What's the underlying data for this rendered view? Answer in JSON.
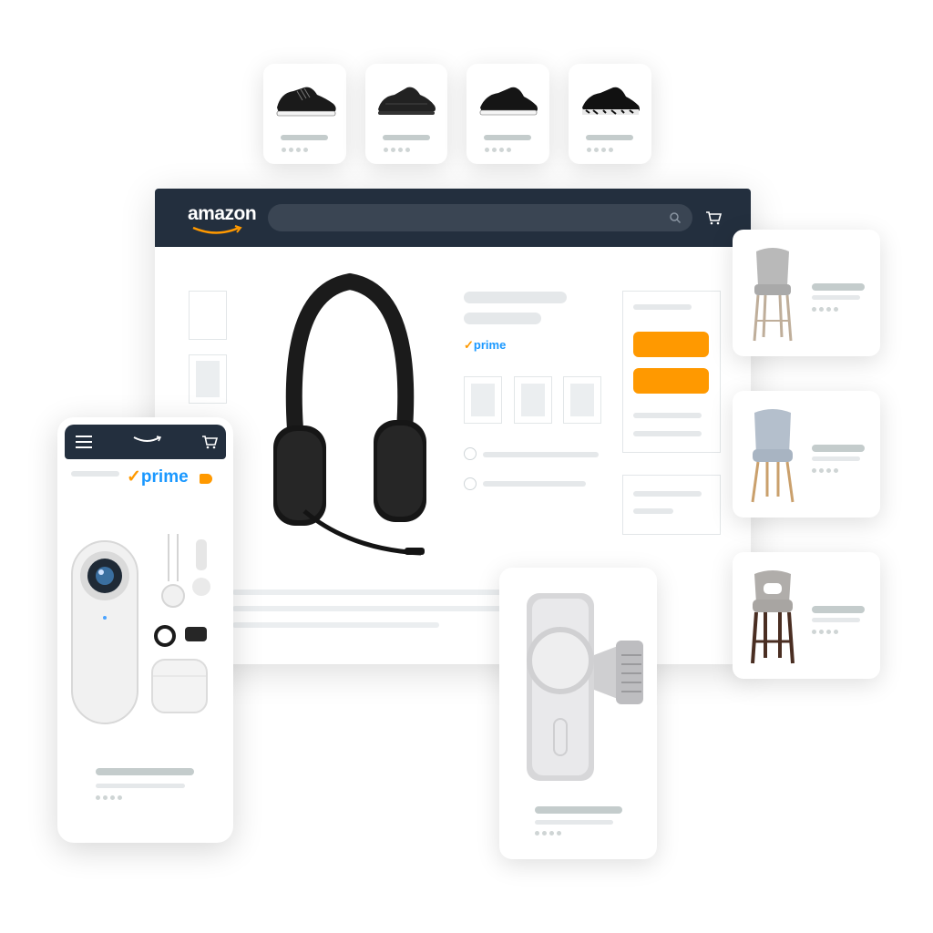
{
  "desktop": {
    "logo": "amazon",
    "search_icon": "search-icon",
    "cart_icon": "cart-icon",
    "badge": "prime"
  },
  "mobile": {
    "menu_icon": "menu-icon",
    "logo_icon": "amazon-smile-logo",
    "cart_icon": "cart-icon",
    "badge": "prime"
  },
  "colors": {
    "header": "#232f3e",
    "accent": "#ff9900",
    "prime_blue": "#1a98ff"
  },
  "product_cards": {
    "shoes": [
      "sneaker-1",
      "sneaker-2",
      "sneaker-3",
      "sneaker-4"
    ],
    "chairs": [
      "bar-stool-grey",
      "chair-blue-grey",
      "bar-stool-dark"
    ],
    "mount": "magsafe-car-mount",
    "headphones": "wireless-headset",
    "action_camera": "action-camera-kit"
  }
}
